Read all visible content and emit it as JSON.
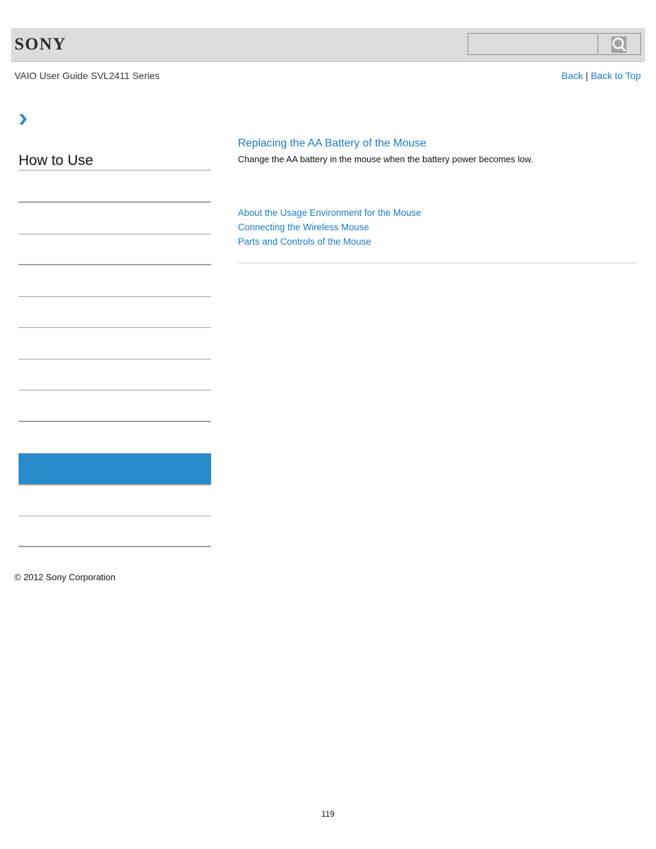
{
  "header": {
    "logo": "SONY",
    "search": {
      "placeholder": "",
      "value": "",
      "button_icon": "search-icon"
    }
  },
  "guide_title": "VAIO User Guide SVL2411 Series",
  "nav": {
    "back": "Back",
    "separator": "|",
    "back_to_top": "Back to Top"
  },
  "breadcrumb": {
    "icon": "chevron-right-icon"
  },
  "sidebar": {
    "title": "How to Use",
    "items": [
      {
        "label": "",
        "active": false
      },
      {
        "label": "",
        "active": false
      },
      {
        "label": "",
        "active": false
      },
      {
        "label": "",
        "active": false
      },
      {
        "label": "",
        "active": false
      },
      {
        "label": "",
        "active": false
      },
      {
        "label": "",
        "active": false
      },
      {
        "label": "",
        "active": false
      },
      {
        "label": "",
        "active": true
      },
      {
        "label": "",
        "active": false
      },
      {
        "label": "",
        "active": false
      }
    ]
  },
  "main": {
    "topic_title": "Replacing the AA Battery of the Mouse",
    "topic_description": "Change the AA battery in the mouse when the battery power becomes low.",
    "related_links": [
      "About the Usage Environment for the Mouse",
      "Connecting the Wireless Mouse",
      "Parts and Controls of the Mouse"
    ]
  },
  "footer": {
    "copyright": "© 2012 Sony Corporation",
    "page_number": "119"
  },
  "colors": {
    "link": "#1a7bc4",
    "active": "#278bcc",
    "header_bg": "#dcdcdc"
  }
}
